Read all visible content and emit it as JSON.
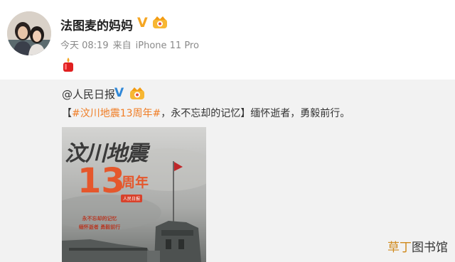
{
  "post": {
    "author_name": "法图麦的妈妈",
    "verified_mark": "V",
    "time": "今天 08:19",
    "source_prefix": "来自",
    "source_device": "iPhone 11 Pro",
    "content_emoji": "candle-icon"
  },
  "repost": {
    "origin_author": "@人民日报",
    "verified_mark": "V",
    "bracket_open": "【",
    "topic": "#汶川地震13周年#",
    "topic_suffix": "，永不忘却的记忆",
    "bracket_close": "】",
    "body": "缅怀逝者，勇毅前行。"
  },
  "poster": {
    "title": "汶川地震",
    "number": "13",
    "years": "周年",
    "logo_text": "人民日报",
    "slogan_lines": [
      "永不忘却的记忆",
      "缅怀逝者  勇毅前行"
    ]
  },
  "watermark": {
    "accent": "草丁",
    "text": "图书馆"
  },
  "colors": {
    "topic": "#f07d25",
    "gold_verified": "#f5a623",
    "blue_verified": "#2f88d8",
    "repost_bg": "#f2f2f2"
  }
}
